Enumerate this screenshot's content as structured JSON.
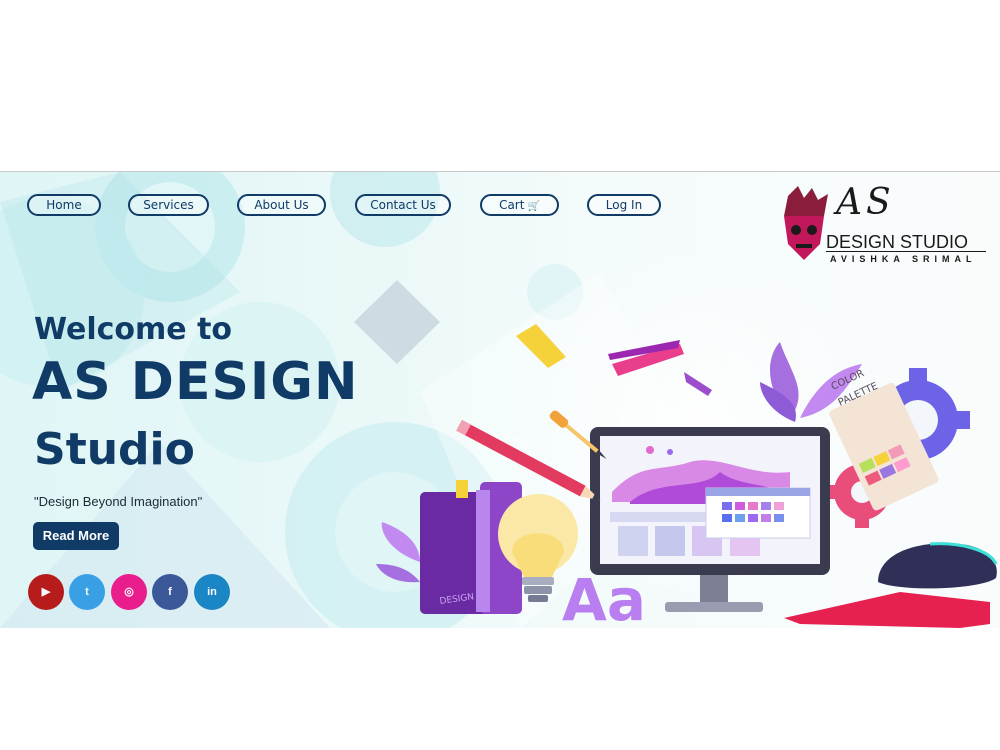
{
  "nav": {
    "home": "Home",
    "services": "Services",
    "about": "About Us",
    "contact": "Contact Us",
    "cart": "Cart",
    "cart_icon": "shopping-cart-icon",
    "login": "Log In"
  },
  "logo": {
    "monogram": "AS",
    "studio": "DESIGN STUDIO",
    "owner": "AVISHKA SRIMAL"
  },
  "hero": {
    "welcome": "Welcome to",
    "brand": "AS DESIGN",
    "studio": "Studio",
    "tagline": "\"Design Beyond Imagination\"",
    "cta": "Read More"
  },
  "illustration": {
    "pencil_label": "DESIGN",
    "book_label": "DESIGN",
    "palette_label_1": "COLOR",
    "palette_label_2": "PALETTE",
    "type_sample": "Aa"
  },
  "socials": [
    {
      "icon": "youtube-icon",
      "glyph": "▶",
      "color": "#b71c1c"
    },
    {
      "icon": "twitter-icon",
      "glyph": "t",
      "color": "#3aa0e6"
    },
    {
      "icon": "instagram-icon",
      "glyph": "◎",
      "color": "#e91e8c"
    },
    {
      "icon": "facebook-icon",
      "glyph": "f",
      "color": "#3b5998"
    },
    {
      "icon": "linkedin-icon",
      "glyph": "in",
      "color": "#1b86c6"
    }
  ],
  "colors": {
    "primary": "#0f3b66",
    "accent_purple": "#7b2fbe",
    "accent_pink": "#e91e63"
  }
}
